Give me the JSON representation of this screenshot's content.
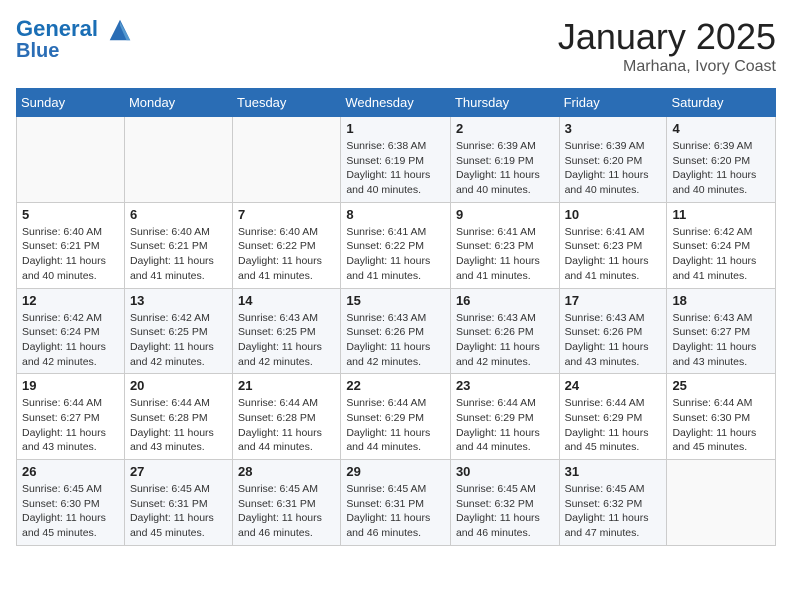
{
  "header": {
    "logo_line1": "General",
    "logo_line2": "Blue",
    "month": "January 2025",
    "location": "Marhana, Ivory Coast"
  },
  "days_of_week": [
    "Sunday",
    "Monday",
    "Tuesday",
    "Wednesday",
    "Thursday",
    "Friday",
    "Saturday"
  ],
  "weeks": [
    [
      {
        "num": "",
        "info": ""
      },
      {
        "num": "",
        "info": ""
      },
      {
        "num": "",
        "info": ""
      },
      {
        "num": "1",
        "info": "Sunrise: 6:38 AM\nSunset: 6:19 PM\nDaylight: 11 hours and 40 minutes."
      },
      {
        "num": "2",
        "info": "Sunrise: 6:39 AM\nSunset: 6:19 PM\nDaylight: 11 hours and 40 minutes."
      },
      {
        "num": "3",
        "info": "Sunrise: 6:39 AM\nSunset: 6:20 PM\nDaylight: 11 hours and 40 minutes."
      },
      {
        "num": "4",
        "info": "Sunrise: 6:39 AM\nSunset: 6:20 PM\nDaylight: 11 hours and 40 minutes."
      }
    ],
    [
      {
        "num": "5",
        "info": "Sunrise: 6:40 AM\nSunset: 6:21 PM\nDaylight: 11 hours and 40 minutes."
      },
      {
        "num": "6",
        "info": "Sunrise: 6:40 AM\nSunset: 6:21 PM\nDaylight: 11 hours and 41 minutes."
      },
      {
        "num": "7",
        "info": "Sunrise: 6:40 AM\nSunset: 6:22 PM\nDaylight: 11 hours and 41 minutes."
      },
      {
        "num": "8",
        "info": "Sunrise: 6:41 AM\nSunset: 6:22 PM\nDaylight: 11 hours and 41 minutes."
      },
      {
        "num": "9",
        "info": "Sunrise: 6:41 AM\nSunset: 6:23 PM\nDaylight: 11 hours and 41 minutes."
      },
      {
        "num": "10",
        "info": "Sunrise: 6:41 AM\nSunset: 6:23 PM\nDaylight: 11 hours and 41 minutes."
      },
      {
        "num": "11",
        "info": "Sunrise: 6:42 AM\nSunset: 6:24 PM\nDaylight: 11 hours and 41 minutes."
      }
    ],
    [
      {
        "num": "12",
        "info": "Sunrise: 6:42 AM\nSunset: 6:24 PM\nDaylight: 11 hours and 42 minutes."
      },
      {
        "num": "13",
        "info": "Sunrise: 6:42 AM\nSunset: 6:25 PM\nDaylight: 11 hours and 42 minutes."
      },
      {
        "num": "14",
        "info": "Sunrise: 6:43 AM\nSunset: 6:25 PM\nDaylight: 11 hours and 42 minutes."
      },
      {
        "num": "15",
        "info": "Sunrise: 6:43 AM\nSunset: 6:26 PM\nDaylight: 11 hours and 42 minutes."
      },
      {
        "num": "16",
        "info": "Sunrise: 6:43 AM\nSunset: 6:26 PM\nDaylight: 11 hours and 42 minutes."
      },
      {
        "num": "17",
        "info": "Sunrise: 6:43 AM\nSunset: 6:26 PM\nDaylight: 11 hours and 43 minutes."
      },
      {
        "num": "18",
        "info": "Sunrise: 6:43 AM\nSunset: 6:27 PM\nDaylight: 11 hours and 43 minutes."
      }
    ],
    [
      {
        "num": "19",
        "info": "Sunrise: 6:44 AM\nSunset: 6:27 PM\nDaylight: 11 hours and 43 minutes."
      },
      {
        "num": "20",
        "info": "Sunrise: 6:44 AM\nSunset: 6:28 PM\nDaylight: 11 hours and 43 minutes."
      },
      {
        "num": "21",
        "info": "Sunrise: 6:44 AM\nSunset: 6:28 PM\nDaylight: 11 hours and 44 minutes."
      },
      {
        "num": "22",
        "info": "Sunrise: 6:44 AM\nSunset: 6:29 PM\nDaylight: 11 hours and 44 minutes."
      },
      {
        "num": "23",
        "info": "Sunrise: 6:44 AM\nSunset: 6:29 PM\nDaylight: 11 hours and 44 minutes."
      },
      {
        "num": "24",
        "info": "Sunrise: 6:44 AM\nSunset: 6:29 PM\nDaylight: 11 hours and 45 minutes."
      },
      {
        "num": "25",
        "info": "Sunrise: 6:44 AM\nSunset: 6:30 PM\nDaylight: 11 hours and 45 minutes."
      }
    ],
    [
      {
        "num": "26",
        "info": "Sunrise: 6:45 AM\nSunset: 6:30 PM\nDaylight: 11 hours and 45 minutes."
      },
      {
        "num": "27",
        "info": "Sunrise: 6:45 AM\nSunset: 6:31 PM\nDaylight: 11 hours and 45 minutes."
      },
      {
        "num": "28",
        "info": "Sunrise: 6:45 AM\nSunset: 6:31 PM\nDaylight: 11 hours and 46 minutes."
      },
      {
        "num": "29",
        "info": "Sunrise: 6:45 AM\nSunset: 6:31 PM\nDaylight: 11 hours and 46 minutes."
      },
      {
        "num": "30",
        "info": "Sunrise: 6:45 AM\nSunset: 6:32 PM\nDaylight: 11 hours and 46 minutes."
      },
      {
        "num": "31",
        "info": "Sunrise: 6:45 AM\nSunset: 6:32 PM\nDaylight: 11 hours and 47 minutes."
      },
      {
        "num": "",
        "info": ""
      }
    ]
  ]
}
